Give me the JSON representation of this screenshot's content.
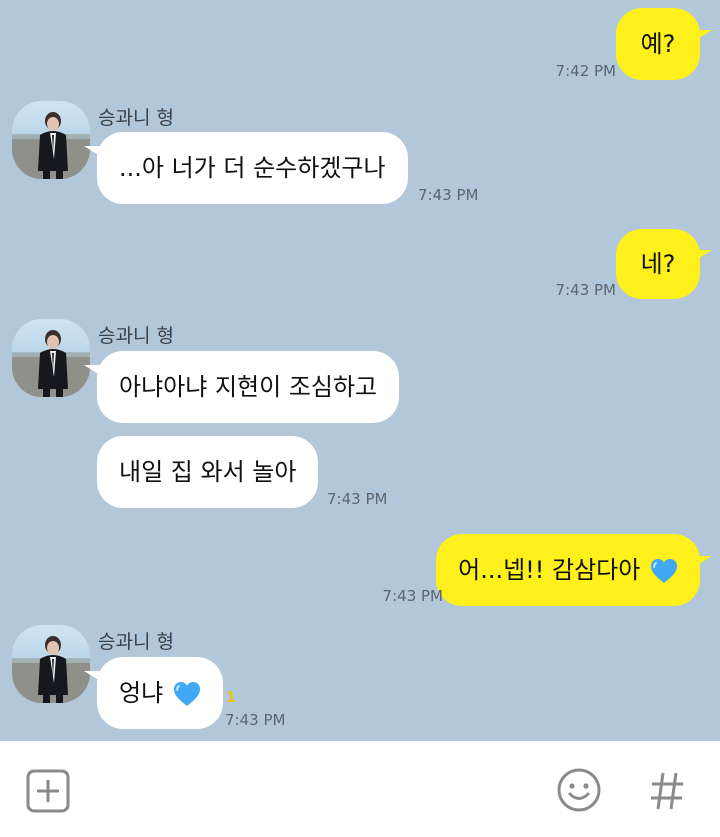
{
  "chat": {
    "contact_name": "승과니 형",
    "messages": [
      {
        "text": "예?",
        "time": "7:42 PM"
      },
      {
        "text": "...아 너가 더 순수하겠구나",
        "time": "7:43 PM"
      },
      {
        "text": "네?",
        "time": "7:43 PM"
      },
      {
        "text": "아냐아냐 지현이 조심하고"
      },
      {
        "text": "내일 집 와서 놀아",
        "time": "7:43 PM"
      },
      {
        "text": "어...넵!! 감삼다아",
        "time": "7:43 PM",
        "emoji": "blue-heart"
      },
      {
        "text": "엉냐",
        "time": "7:43 PM",
        "emoji": "blue-heart",
        "unread": "1"
      }
    ]
  },
  "inputbar": {
    "icons": [
      "plus-icon",
      "emoji-icon",
      "hashtag-icon"
    ]
  },
  "colors": {
    "background": "#b2c7d9",
    "my_bubble": "#fef01b",
    "their_bubble": "#ffffff",
    "unread": "#e9c800",
    "heart": "#3fa9f5"
  }
}
